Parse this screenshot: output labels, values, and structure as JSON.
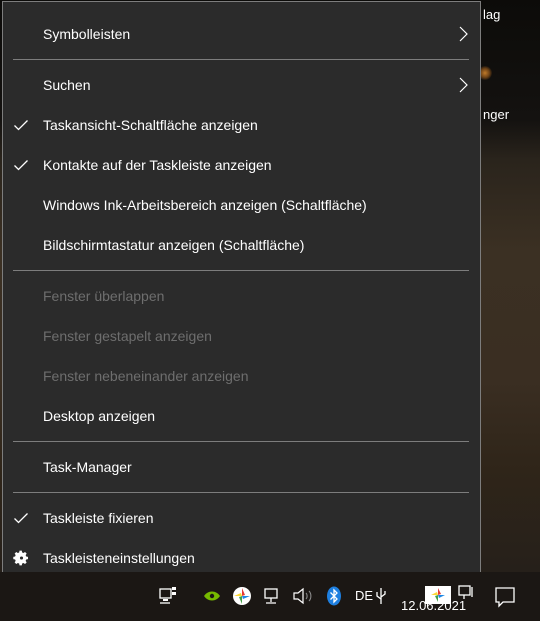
{
  "desktop": {
    "text_1": "lag",
    "text_2": "nger"
  },
  "menu": {
    "items": [
      {
        "label": "Symbolleisten",
        "checked": false,
        "submenu": true,
        "disabled": false
      },
      {
        "label": "Suchen",
        "checked": false,
        "submenu": true,
        "disabled": false
      },
      {
        "label": "Taskansicht-Schaltfläche anzeigen",
        "checked": true,
        "submenu": false,
        "disabled": false
      },
      {
        "label": "Kontakte auf der Taskleiste anzeigen",
        "checked": true,
        "submenu": false,
        "disabled": false
      },
      {
        "label": "Windows Ink-Arbeitsbereich anzeigen (Schaltfläche)",
        "checked": false,
        "submenu": false,
        "disabled": false
      },
      {
        "label": "Bildschirmtastatur anzeigen (Schaltfläche)",
        "checked": false,
        "submenu": false,
        "disabled": false
      },
      {
        "label": "Fenster überlappen",
        "checked": false,
        "submenu": false,
        "disabled": true
      },
      {
        "label": "Fenster gestapelt anzeigen",
        "checked": false,
        "submenu": false,
        "disabled": true
      },
      {
        "label": "Fenster nebeneinander anzeigen",
        "checked": false,
        "submenu": false,
        "disabled": true
      },
      {
        "label": "Desktop anzeigen",
        "checked": false,
        "submenu": false,
        "disabled": false
      },
      {
        "label": "Task-Manager",
        "checked": false,
        "submenu": false,
        "disabled": false
      },
      {
        "label": "Taskleiste fixieren",
        "checked": true,
        "submenu": false,
        "disabled": false
      },
      {
        "label": "Taskleisteneinstellungen",
        "checked": false,
        "submenu": false,
        "disabled": false,
        "icon": "gear-icon"
      }
    ]
  },
  "taskbar": {
    "language": "DE",
    "date": "12.06.2021",
    "icons": [
      "network-icon",
      "nvidia-icon",
      "color-app-icon",
      "network-icon",
      "speaker-icon",
      "bluetooth-icon",
      "usb-icon",
      "color-app-icon",
      "network-icon",
      "notification-icon"
    ]
  },
  "colors": {
    "menu_bg": "#2b2b2b",
    "menu_border": "#7d7d7d",
    "text": "#ffffff",
    "text_disabled": "#6e6e6e",
    "bluetooth": "#1e7fe0",
    "nvidia": "#76b900"
  }
}
